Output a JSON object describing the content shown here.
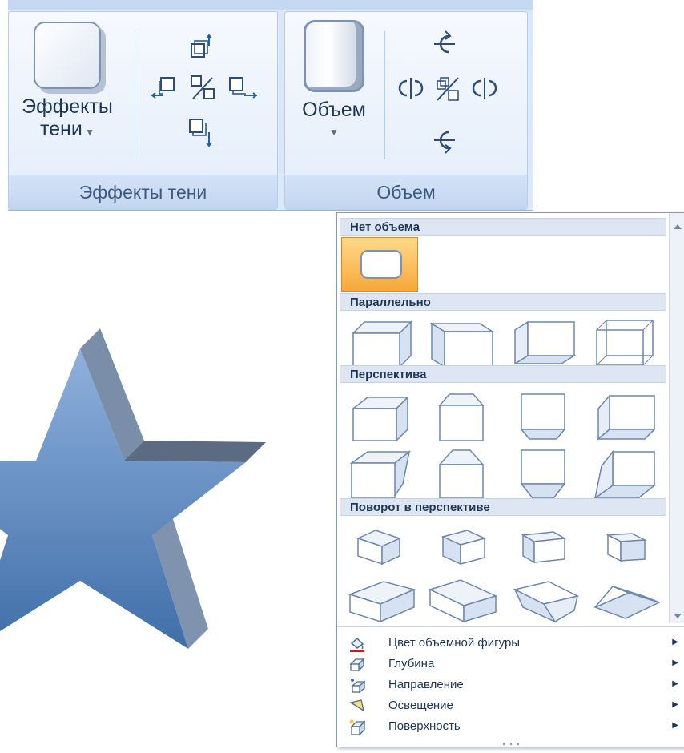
{
  "ribbon": {
    "shadow_group": {
      "big_button_line1": "Эффекты",
      "big_button_line2": "тени",
      "label": "Эффекты тени"
    },
    "volume_group": {
      "big_button_label": "Объем",
      "label": "Объем"
    }
  },
  "menu": {
    "sections": [
      {
        "title": "Нет объема"
      },
      {
        "title": "Параллельно"
      },
      {
        "title": "Перспектива"
      },
      {
        "title": "Поворот в перспективе"
      }
    ],
    "items": [
      {
        "label": "Цвет объемной фигуры",
        "icon": "paint-bucket-icon"
      },
      {
        "label": "Глубина",
        "icon": "depth-icon"
      },
      {
        "label": "Направление",
        "icon": "direction-icon"
      },
      {
        "label": "Освещение",
        "icon": "lighting-icon"
      },
      {
        "label": "Поверхность",
        "icon": "surface-icon"
      }
    ]
  },
  "colors": {
    "star_light": "#8fb0dc",
    "star_dark": "#3f6ea8",
    "selection": "#f6a83a"
  }
}
